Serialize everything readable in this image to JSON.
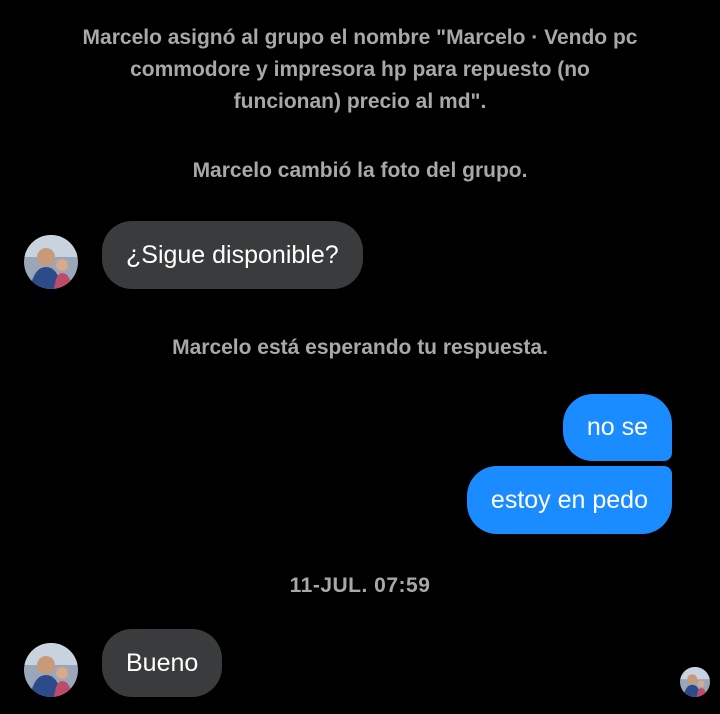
{
  "system_messages": {
    "rename_lines": [
      "Marcelo asignó al grupo el nombre \"Marcelo · Vendo pc",
      "commodore y impresora hp para repuesto (no",
      "funcionan) precio al md\"."
    ],
    "photo_changed": "Marcelo cambió la foto del grupo.",
    "waiting": "Marcelo está esperando tu respuesta."
  },
  "messages": {
    "incoming_1": "¿Sigue disponible?",
    "outgoing_1": "no se",
    "outgoing_2": "estoy en pedo",
    "incoming_2": "Bueno"
  },
  "timestamp": "11-JUL. 07:59",
  "colors": {
    "background": "#000000",
    "incoming_bubble": "#3a3b3c",
    "outgoing_bubble": "#1a8cff",
    "system_text": "#a8a8a8"
  },
  "icons": {
    "sender_avatar": "avatar",
    "read_receipt": "read-receipt-avatar"
  }
}
